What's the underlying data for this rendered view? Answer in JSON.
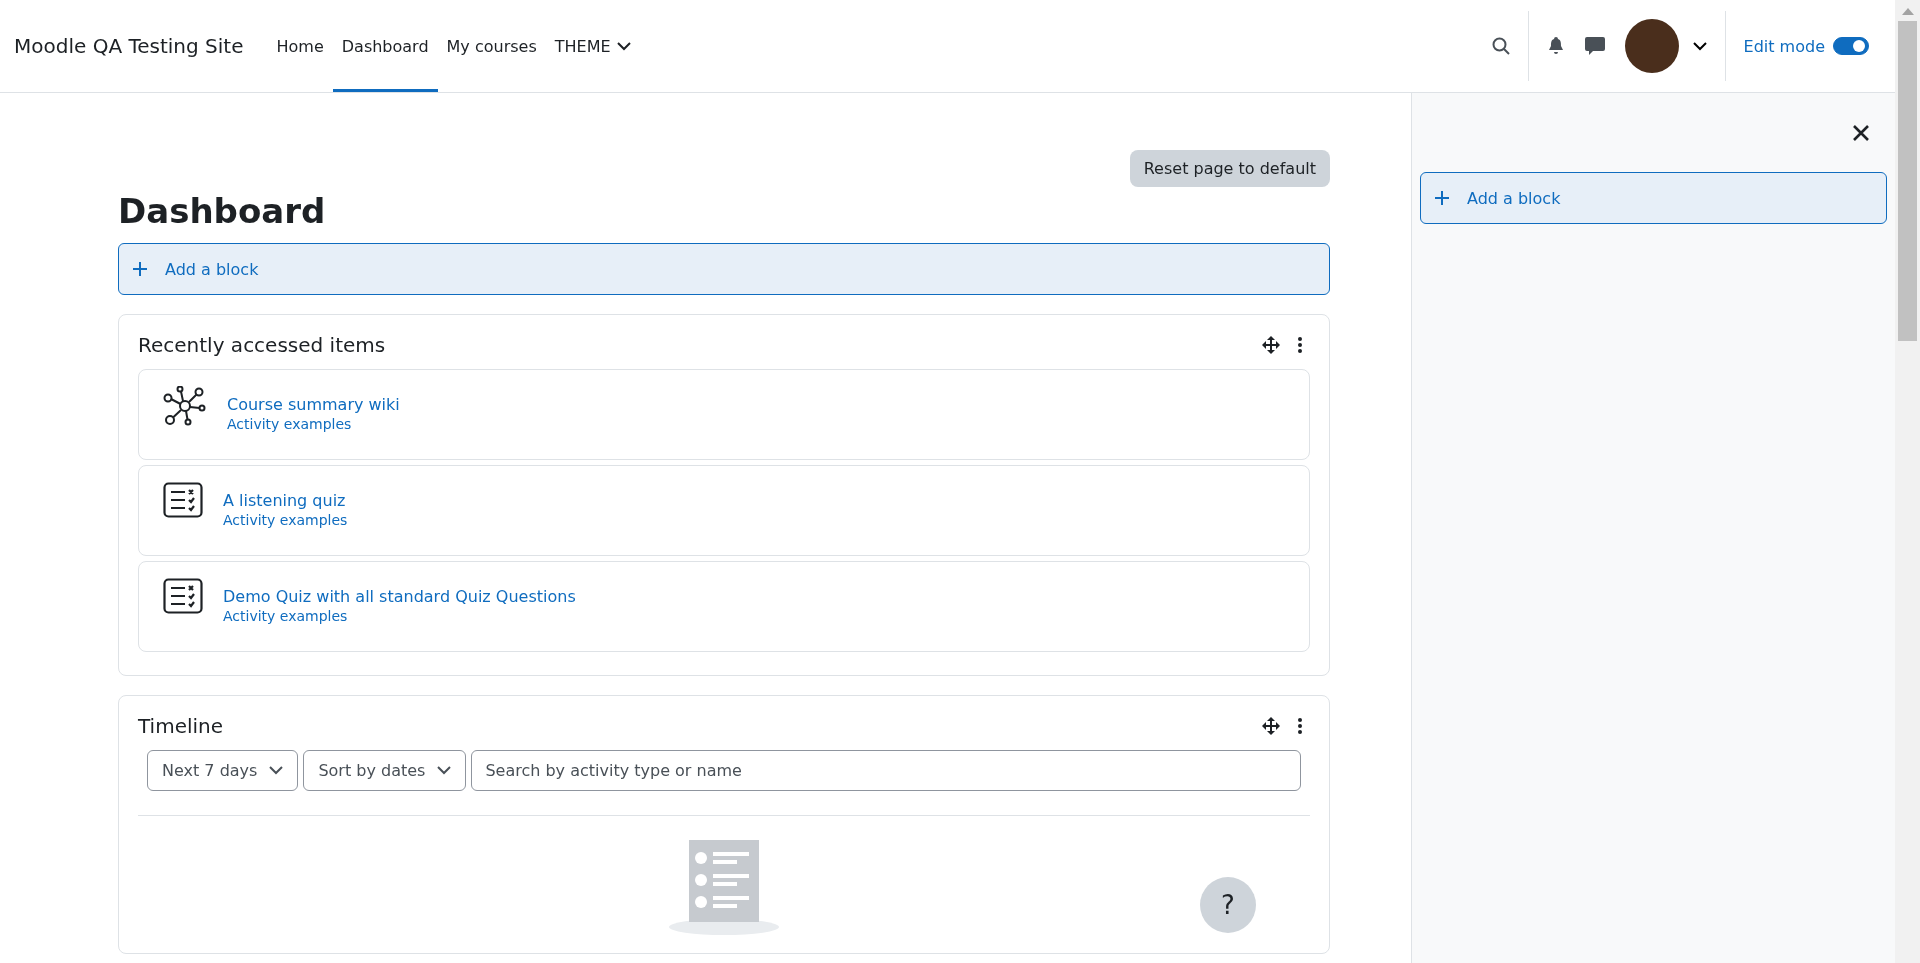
{
  "header": {
    "site_name": "Moodle QA Testing Site",
    "nav": [
      {
        "label": "Home",
        "selected": false,
        "kind": "link"
      },
      {
        "label": "Dashboard",
        "selected": true,
        "kind": "link"
      },
      {
        "label": "My courses",
        "selected": false,
        "kind": "link"
      },
      {
        "label": "THEME",
        "selected": false,
        "kind": "dropdown"
      }
    ],
    "edit_mode": {
      "label": "Edit mode",
      "on": true
    }
  },
  "main": {
    "reset_button": "Reset page to default",
    "title": "Dashboard",
    "add_block": "Add a block",
    "recent": {
      "title": "Recently accessed items",
      "items": [
        {
          "title": "Course summary wiki",
          "subtitle": "Activity examples",
          "kind": "wiki"
        },
        {
          "title": "A listening quiz",
          "subtitle": "Activity examples",
          "kind": "quiz"
        },
        {
          "title": "Demo Quiz with all standard Quiz Questions",
          "subtitle": "Activity examples",
          "kind": "quiz"
        }
      ]
    },
    "timeline": {
      "title": "Timeline",
      "filters": [
        "Next 7 days",
        "Sort by dates"
      ],
      "search": {
        "placeholder": "Search by activity type or name"
      }
    }
  },
  "drawer": {
    "add_block": "Add a block"
  },
  "help_button": "?"
}
